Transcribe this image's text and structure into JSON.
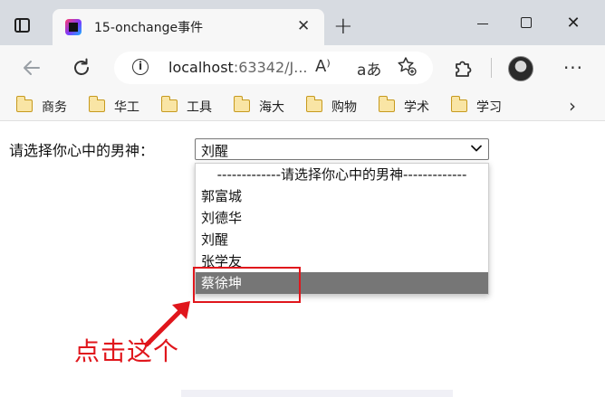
{
  "browser": {
    "tab_title": "15-onchange事件",
    "tab_close": "✕",
    "new_tab": "+",
    "window_controls": {
      "close": "✕"
    },
    "address_bar": {
      "url_host": "localhost",
      "url_rest": ":63342/J...",
      "read_aloud_icon": "A⁾",
      "translate_icon": "aあ"
    },
    "bookmarks": [
      {
        "label": "商务"
      },
      {
        "label": "华工"
      },
      {
        "label": "工具"
      },
      {
        "label": "海大"
      },
      {
        "label": "购物"
      },
      {
        "label": "学术"
      },
      {
        "label": "学习"
      }
    ]
  },
  "page": {
    "prompt_label": "请选择你心中的男神：",
    "select": {
      "current_value": "刘醒",
      "options": [
        "-------------请选择你心中的男神-------------",
        "郭富城",
        "刘德华",
        "刘醒",
        "张学友",
        "蔡徐坤"
      ],
      "highlighted_option": "蔡徐坤"
    },
    "annotation_text": "点击这个"
  },
  "colors": {
    "annotation": "#e0161c",
    "option_highlight": "#767676",
    "tabbar": "#d7dbe1",
    "toolbar": "#f7f7f7"
  }
}
